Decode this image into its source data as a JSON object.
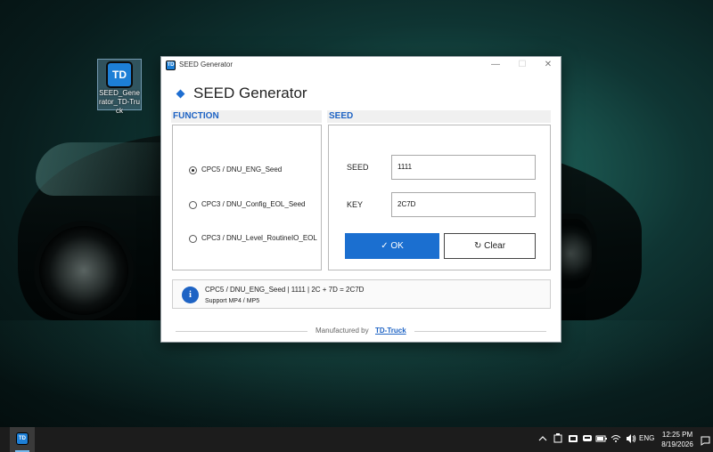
{
  "desktop": {
    "icon": {
      "tile": "TD",
      "label": "SEED_Generator_TD-Truck"
    }
  },
  "window": {
    "title": "SEED Generator",
    "app_icon": "TD",
    "controls": {
      "minimize": "—",
      "maximize": "☐",
      "close": "✕"
    },
    "header": "SEED Generator",
    "function": {
      "title": "FUNCTION",
      "options": [
        {
          "label": "CPC5 / DNU_ENG_Seed",
          "selected": true
        },
        {
          "label": "CPC3 / DNU_Config_EOL_Seed",
          "selected": false
        },
        {
          "label": "CPC3 / DNU_Level_RoutineIO_EOL",
          "selected": false
        }
      ]
    },
    "seed": {
      "title": "SEED",
      "seed_label": "SEED",
      "seed_value": "1111",
      "key_label": "KEY",
      "key_value": "2C7D",
      "ok_label": "✓  OK",
      "clear_label": "↻  Clear"
    },
    "info": {
      "icon": "i",
      "line1": "CPC5 / DNU_ENG_Seed   |   1111   |   2C + 7D = 2C7D",
      "line2": "Support MP4 / MP5"
    },
    "footer": {
      "made": "Manufactured by",
      "link": "TD-Truck"
    }
  },
  "taskbar": {
    "app_tile": "TD",
    "lang": "ENG",
    "time": "12:25 PM",
    "date": "8/19/2026"
  }
}
